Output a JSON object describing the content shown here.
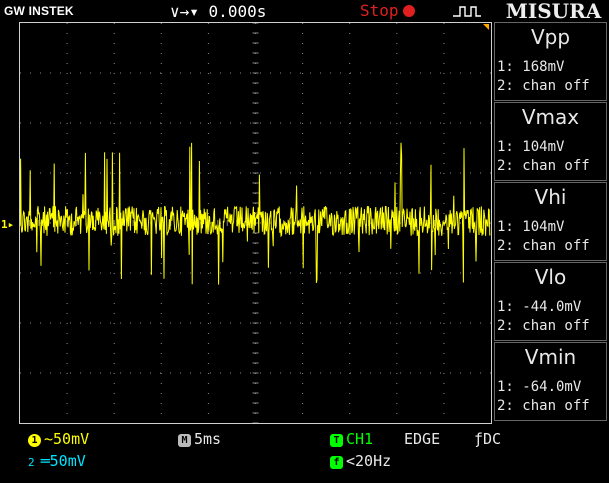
{
  "header": {
    "brand": "GW INSTEK",
    "time_offset": "0.000s",
    "run_state": "Stop",
    "menu_title": "MISURA"
  },
  "measurements": [
    {
      "name": "Vpp",
      "ch1": "1: 168mV",
      "ch2": "2: chan off"
    },
    {
      "name": "Vmax",
      "ch1": "1: 104mV",
      "ch2": "2: chan off"
    },
    {
      "name": "Vhi",
      "ch1": "1: 104mV",
      "ch2": "2: chan off"
    },
    {
      "name": "Vlo",
      "ch1": "1: -44.0mV",
      "ch2": "2: chan off"
    },
    {
      "name": "Vmin",
      "ch1": "1: -64.0mV",
      "ch2": "2: chan off"
    }
  ],
  "channel_marker": "1",
  "footer": {
    "ch1_badge": "1",
    "ch1_coupling": "~",
    "ch1_scale": "50mV",
    "ch2_badge": "2",
    "ch2_coupling": "═",
    "ch2_scale": "50mV",
    "timebase_badge": "M",
    "timebase": "5ms",
    "trigger_badge": "T",
    "trigger_source": "CH1",
    "trigger_type": "EDGE",
    "trigger_coupling": "ƒDC",
    "freq_badge": "f",
    "frequency": "<20Hz"
  },
  "colors": {
    "ch1": "#ffff00",
    "ch2": "#00e5ff",
    "trigger": "#00ff00",
    "stop": "#e02020",
    "grid": "#8a8a8a"
  }
}
